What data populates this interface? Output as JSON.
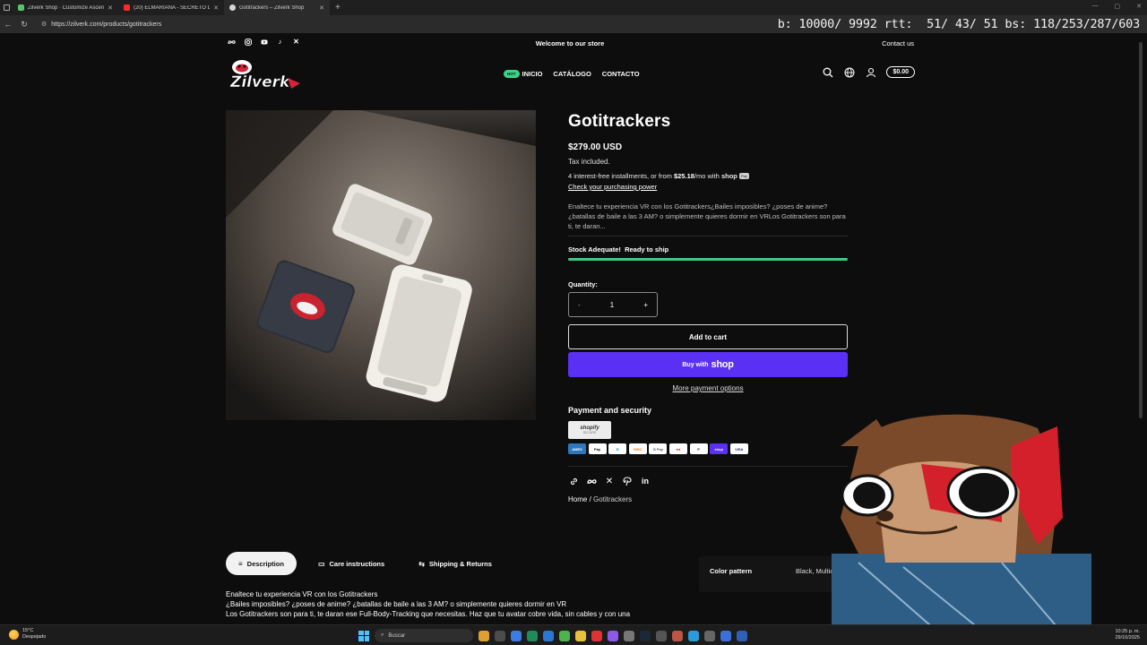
{
  "browser": {
    "tabs": [
      {
        "label": "Zilverk Shop · Customize Ascend",
        "color": "#5bc36d",
        "active": false
      },
      {
        "label": "(20) ELMARIANA - SECRETO DE A",
        "color": "#ff2a2a",
        "active": false
      },
      {
        "label": "Gotitrackers – Zilverk Shop",
        "color": "#d6d6d6",
        "active": true
      }
    ],
    "new_tab": "+",
    "url": "https://zilverk.com/products/gotitrackers",
    "overlay_stats": "b: 10000/ 9992 rtt:  51/ 43/ 51 bs: 118/253/287/603"
  },
  "store": {
    "announcement": "Welcome to our store",
    "contact_link": "Contact us",
    "social_icons": [
      "meta-icon",
      "instagram-icon",
      "youtube-icon",
      "tiktok-icon",
      "x-icon"
    ],
    "logo_text": "Zilverk",
    "nav": {
      "hot_badge": "HOT",
      "items": [
        "INICIO",
        "CATÁLOGO",
        "CONTACTO"
      ]
    },
    "cart_total": "$0.00"
  },
  "product": {
    "title": "Gotitrackers",
    "price": "$279.00 USD",
    "tax_note": "Tax included.",
    "installments_prefix": "4 interest-free installments, or from ",
    "installments_amount": "$25.18",
    "installments_suffix": "/mo with ",
    "installments_brand": "shop",
    "installments_badge": "Pay",
    "purchasing_power_link": "Check your purchasing power",
    "short_description": "Enaltece tu experiencia VR con los Gotitrackers¿Bailes imposibles? ¿poses de anime? ¿batallas de baile a las 3 AM? o simplemente quieres dormir en VRLos Gotitrackers son para ti, te daran...",
    "stock_label": "Stock Adequate!",
    "stock_status": "Ready to ship",
    "stock_level": 1.0,
    "quantity_label": "Quantity:",
    "quantity_minus": "-",
    "quantity_value": "1",
    "quantity_plus": "+",
    "add_to_cart": "Add to cart",
    "buy_with": "Buy with",
    "buy_brand": "shop",
    "more_payment": "More payment options",
    "payment_security": "Payment and security",
    "shopify_badge_title": "shopify",
    "shopify_badge_sub": "SECURE",
    "payment_cards": [
      {
        "name": "AMEX",
        "bg": "#2e77bc",
        "fg": "#ffffff"
      },
      {
        "name": "Pay",
        "bg": "#ffffff",
        "fg": "#000000"
      },
      {
        "name": "D",
        "bg": "#ffffff",
        "fg": "#0079be"
      },
      {
        "name": "DISC",
        "bg": "#ffffff",
        "fg": "#e07a1a"
      },
      {
        "name": "G Pay",
        "bg": "#ffffff",
        "fg": "#555555"
      },
      {
        "name": "●●",
        "bg": "#ffffff",
        "fg": "#eb001b"
      },
      {
        "name": "P",
        "bg": "#ffffff",
        "fg": "#003087"
      },
      {
        "name": "shop",
        "bg": "#5a31f4",
        "fg": "#ffffff"
      },
      {
        "name": "VISA",
        "bg": "#ffffff",
        "fg": "#1a1f71"
      }
    ],
    "share_icons": [
      "link-icon",
      "meta-icon",
      "x-icon",
      "pinterest-icon",
      "linkedin-icon"
    ],
    "breadcrumb_home": "Home",
    "breadcrumb_sep": "/",
    "breadcrumb_current": "Gotitrackers"
  },
  "details": {
    "tabs": [
      "Description",
      "Care instructions",
      "Shipping & Returns"
    ],
    "spec_key": "Color pattern",
    "spec_value": "Black, Multicolor",
    "long_description": [
      "Enaltece tu experiencia VR con los Gotitrackers",
      "¿Bailes imposibles? ¿poses de anime? ¿batallas de baile a las 3 AM? o simplemente quieres dormir en VR",
      "Los Gotitrackers son para ti, te daran ese Full-Body-Tracking que necesitas. Haz que tu avatar cobre vida, sin cables y con una"
    ]
  },
  "taskbar": {
    "temperature": "15°C",
    "weather": "Despejado",
    "search_placeholder": "Buscar",
    "time": "10:25 p. m.",
    "date": "29/10/2025"
  },
  "colors": {
    "accent_green": "#3ec983",
    "shop_purple": "#5a31f4",
    "background": "#0d0d0d"
  }
}
